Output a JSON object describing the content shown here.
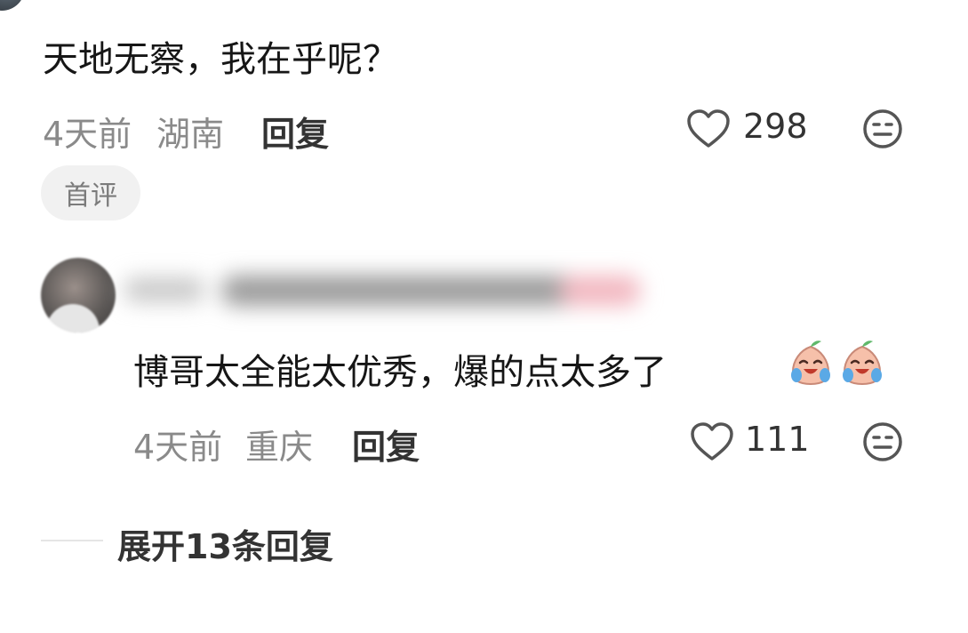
{
  "comment1": {
    "text": "天地无察，我在乎呢？",
    "time": "4天前",
    "location": "湖南",
    "reply_label": "回复",
    "likes": "298",
    "badge": "首评"
  },
  "comment2": {
    "text": "博哥太全能太优秀，爆的点太多了",
    "emoji_icons": [
      "crying-laughing-peach-emoji",
      "crying-laughing-peach-emoji"
    ],
    "time": "4天前",
    "location": "重庆",
    "reply_label": "回复",
    "likes": "111"
  },
  "expand_replies": "展开13条回复"
}
